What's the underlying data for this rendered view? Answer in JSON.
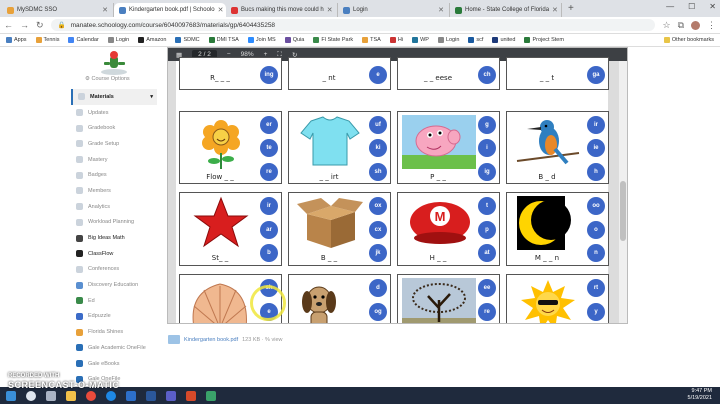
{
  "browser": {
    "tabs": [
      {
        "label": "MySDMC SSO",
        "color": "#e8a13a"
      },
      {
        "label": "Kindergarten book.pdf | Schoolo",
        "color": "#4a7fc0"
      },
      {
        "label": "Bucs making this move could h",
        "color": "#d33"
      },
      {
        "label": "Login",
        "color": "#4a7fc0"
      },
      {
        "label": "Home - State College of Florida",
        "color": "#2a7a3a"
      }
    ],
    "active_tab": 1,
    "url": "manatee.schoology.com/course/6040097683/materials/gp/6404435258",
    "bookmarks": [
      "Apps",
      "Tennis",
      "Calendar",
      "Login",
      "Amazon",
      "SDMC",
      "DMI TSA",
      "Join MS",
      "Quia",
      "Fl State Park",
      "TSA",
      "Hi",
      "WP",
      "Login",
      "scf",
      "united",
      "Project Stem"
    ],
    "other_bookmarks": "Other bookmarks"
  },
  "sidebar": {
    "course_options": "Course Options",
    "items": [
      "Materials",
      "Updates",
      "Gradebook",
      "Grade Setup",
      "Mastery",
      "Badges",
      "Members",
      "Analytics",
      "Workload Planning",
      "Big Ideas Math",
      "ClassFlow",
      "Conferences",
      "Discovery Education",
      "Ed",
      "Edpuzzle",
      "Florida Shines",
      "Gale Academic OneFile",
      "Gale eBooks",
      "Gale OneFile"
    ]
  },
  "pdf": {
    "page_indicator": "2 / 2",
    "zoom": "98%",
    "top_row": [
      {
        "word": "R_ _ _",
        "opt": "ing"
      },
      {
        "word": "_ nt",
        "opt": "e"
      },
      {
        "word": "_ _ eese",
        "opt": "ch"
      },
      {
        "word": "_ _ t",
        "opt": "ga"
      }
    ],
    "row1": [
      {
        "word": "Flow _ _",
        "opts": [
          "er",
          "te",
          "re"
        ]
      },
      {
        "word": "_ _ irt",
        "opts": [
          "uf",
          "ki",
          "sh"
        ]
      },
      {
        "word": "P _ _",
        "opts": [
          "g",
          "i",
          "ig"
        ]
      },
      {
        "word": "B _ d",
        "opts": [
          "ir",
          "ie",
          "h"
        ]
      }
    ],
    "row2": [
      {
        "word": "St_ _",
        "opts": [
          "ir",
          "ar",
          "b"
        ]
      },
      {
        "word": "B _ _",
        "opts": [
          "ox",
          "cx",
          "jk"
        ]
      },
      {
        "word": "H _ _",
        "opts": [
          "t",
          "p",
          "at"
        ]
      },
      {
        "word": "M _ _ n",
        "opts": [
          "oo",
          "o",
          "n"
        ]
      }
    ],
    "row3": [
      {
        "opts": [
          "sh",
          "e"
        ]
      },
      {
        "opts": [
          "d",
          "og"
        ]
      },
      {
        "opts": [
          "ee",
          "re"
        ]
      },
      {
        "opts": [
          "rt",
          "y"
        ]
      }
    ]
  },
  "file": {
    "name": "Kindergarten book.pdf",
    "meta": "123 KB · % view"
  },
  "watermark": {
    "line1": "RECORDED WITH",
    "line2": "SCREENCAST-O-MATIC"
  },
  "tray": {
    "time": "9:47 PM",
    "date": "5/19/2021"
  }
}
